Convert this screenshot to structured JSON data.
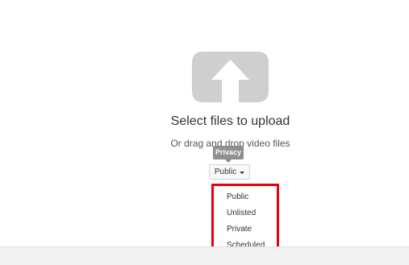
{
  "upload": {
    "title": "Select files to upload",
    "subtitle": "Or drag and drop video files",
    "icon": "upload-arrow-icon",
    "icon_color": "#cfcfcf"
  },
  "privacy": {
    "tooltip": "Privacy",
    "selected": "Public",
    "options": [
      {
        "label": "Public"
      },
      {
        "label": "Unlisted"
      },
      {
        "label": "Private"
      },
      {
        "label": "Scheduled"
      }
    ],
    "highlight_color": "#e8000b"
  }
}
